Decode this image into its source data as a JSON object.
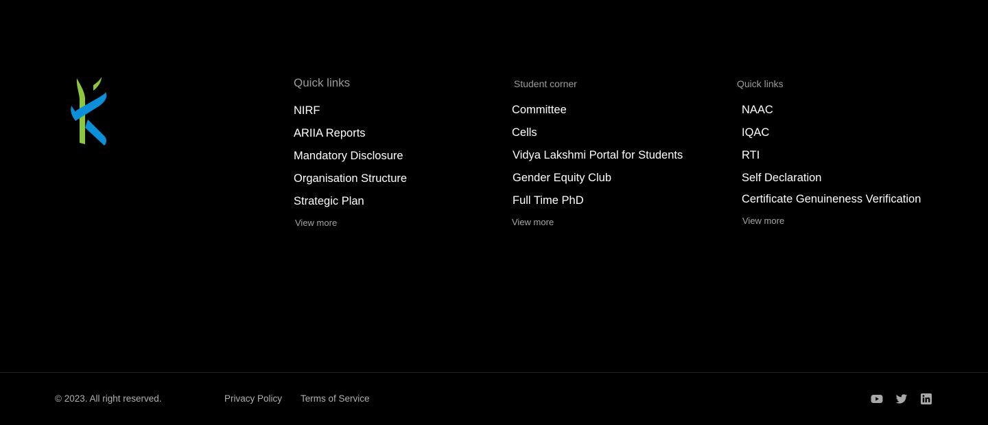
{
  "logo": {
    "icon": "institute-logo-icon",
    "colors": {
      "green": "#8dc63f",
      "blue": "#0a8fd8"
    }
  },
  "columns": [
    {
      "heading": "Quick links",
      "links": [
        "NIRF",
        "ARIIA Reports",
        "Mandatory Disclosure",
        "Organisation Structure",
        "Strategic Plan"
      ],
      "view_more": "View more"
    },
    {
      "heading": "Student corner",
      "links": [
        "Committee",
        "Cells",
        "Vidya Lakshmi Portal for Students",
        "Gender Equity Club",
        "Full Time PhD"
      ],
      "view_more": "View more"
    },
    {
      "heading": "Quick links",
      "links": [
        "NAAC",
        "IQAC",
        "RTI",
        "Self Declaration",
        "Certificate Genuineness Verification"
      ],
      "view_more": "View more"
    }
  ],
  "bottom": {
    "copyright": "© 2023. All right reserved.",
    "privacy": "Privacy Policy",
    "terms": "Terms of Service",
    "social": [
      "youtube-icon",
      "twitter-icon",
      "linkedin-icon"
    ]
  },
  "colors": {
    "background": "#000000",
    "muted_text": "#9b9b9b",
    "link_text": "#ffffff"
  }
}
